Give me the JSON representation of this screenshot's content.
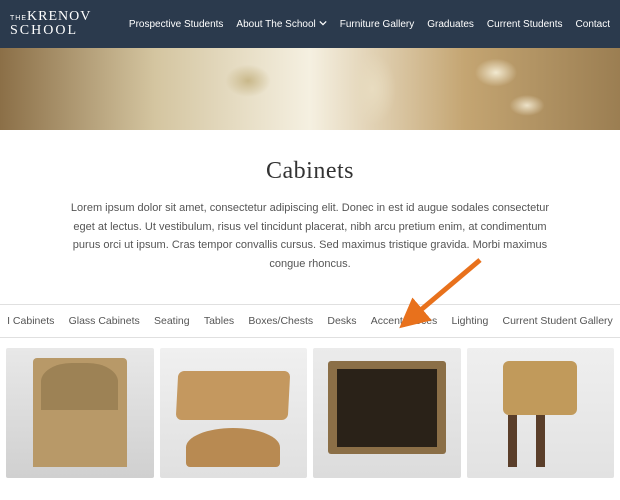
{
  "header": {
    "logo": {
      "the": "THE",
      "name_top": "KRENOV",
      "name_bottom": "SCHOOL"
    },
    "nav": [
      {
        "label": "Prospective Students",
        "dropdown": false
      },
      {
        "label": "About The School",
        "dropdown": true
      },
      {
        "label": "Furniture Gallery",
        "dropdown": false
      },
      {
        "label": "Graduates",
        "dropdown": false
      },
      {
        "label": "Current Students",
        "dropdown": false
      },
      {
        "label": "Contact",
        "dropdown": false
      }
    ]
  },
  "page": {
    "title": "Cabinets",
    "description": "Lorem ipsum dolor sit amet, consectetur adipiscing elit. Donec in est id augue sodales consectetur eget at lectus. Ut vestibulum, risus vel tincidunt placerat, nibh arcu pretium enim, at condimentum purus orci ut ipsum. Cras tempor convallis cursus. Sed maximus tristique gravida. Morbi maximus congue rhoncus."
  },
  "categories": [
    "I Cabinets",
    "Glass Cabinets",
    "Seating",
    "Tables",
    "Boxes/Chests",
    "Desks",
    "Accent Pieces",
    "Lighting",
    "Current Student Gallery"
  ],
  "gallery": {
    "thumbs": [
      {
        "name": "hutch-cabinet"
      },
      {
        "name": "jewelry-box-tambour"
      },
      {
        "name": "book-cubby"
      },
      {
        "name": "side-table-cabinet"
      }
    ]
  },
  "annotation": {
    "arrow_color": "#e8711c",
    "arrow_target": "Accent Pieces"
  }
}
